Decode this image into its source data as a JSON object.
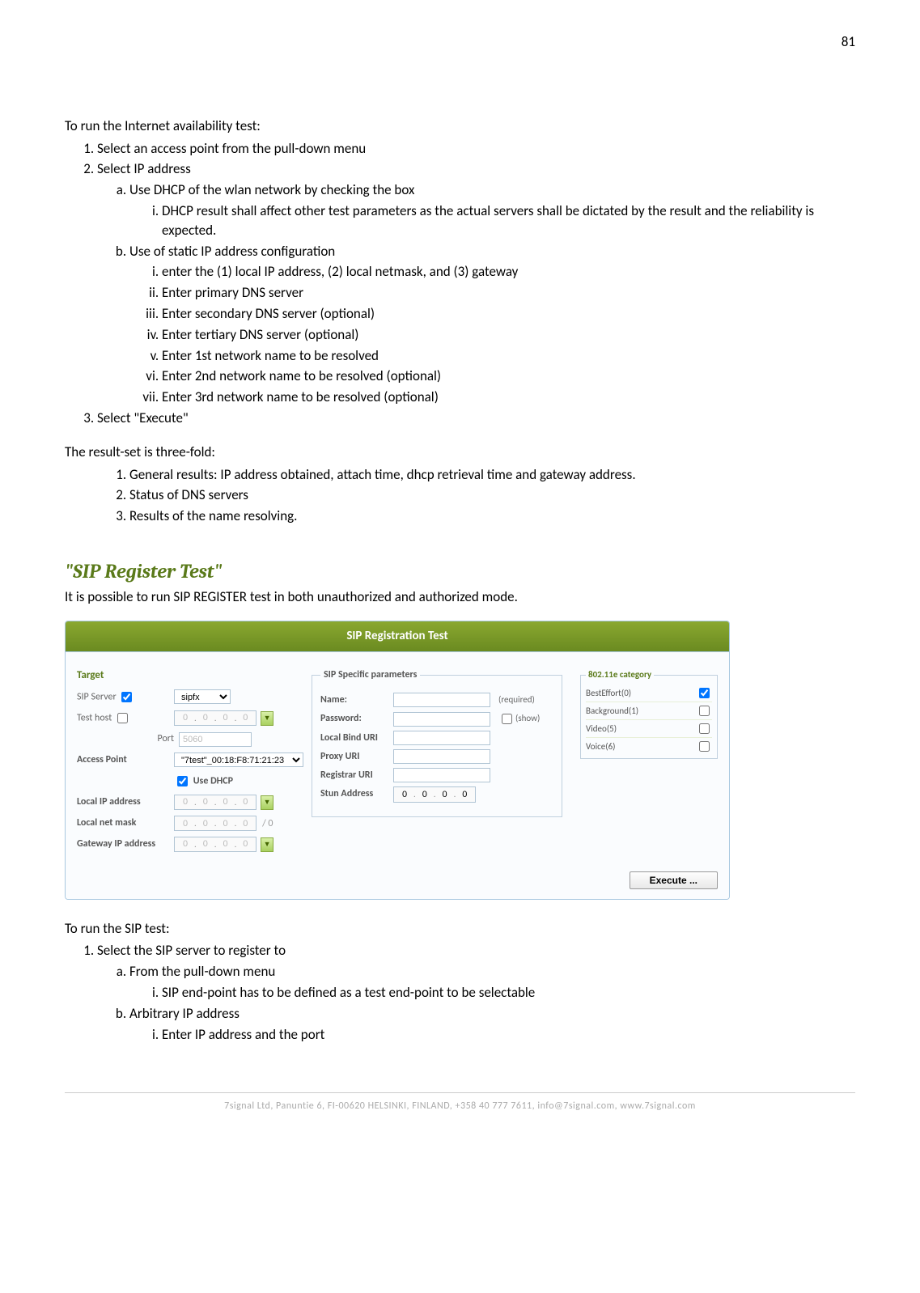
{
  "page_number": "81",
  "text": {
    "intro_internet": "To run the Internet availability test:",
    "step1": "Select an access point from the pull-down menu",
    "step2": "Select IP address",
    "step2a": "Use DHCP of the wlan network by checking the box",
    "step2a_i": "DHCP result shall affect other test parameters as the actual servers shall be dictated by the result and the reliability is expected.",
    "step2b": "Use of static IP address configuration",
    "step2b_i": "enter the (1) local IP address, (2) local netmask, and (3) gateway",
    "step2b_ii": "Enter primary DNS server",
    "step2b_iii": "Enter secondary DNS server (optional)",
    "step2b_iv": "Enter tertiary DNS server (optional)",
    "step2b_v": "Enter 1st network name to be resolved",
    "step2b_vi": "Enter 2nd network name to be resolved (optional)",
    "step2b_vii": "Enter 3rd network name to be resolved (optional)",
    "step3": "Select \"Execute\"",
    "result_intro": "The result-set is three-fold:",
    "result1": "General results: IP address obtained, attach time, dhcp retrieval time and gateway address.",
    "result2": "Status of DNS servers",
    "result3": "Results of the name resolving.",
    "sip_heading": "\"SIP Register Test\"",
    "sip_intro": "It is possible to run SIP REGISTER test in both unauthorized and authorized mode.",
    "sip_run_intro": "To run the SIP test:",
    "sip_step1": "Select the SIP server to register to",
    "sip_step1a": "From the pull-down menu",
    "sip_step1a_i": "SIP end-point has to be defined as a test end-point to be selectable",
    "sip_step1b": "Arbitrary IP address",
    "sip_step1b_i": "Enter IP address and the port"
  },
  "screenshot": {
    "header": "SIP Registration Test",
    "target": {
      "title": "Target",
      "sip_server_label": "SIP Server",
      "sip_server_value": "sipfx",
      "test_host_label": "Test host",
      "port_label": "Port",
      "port_value": "5060",
      "access_point_label": "Access Point",
      "access_point_value": "\"7test\"_00:18:F8:71:21:23",
      "use_dhcp_label": "Use DHCP",
      "local_ip_label": "Local IP address",
      "local_net_label": "Local net mask",
      "gateway_label": "Gateway IP address"
    },
    "sip_params": {
      "legend": "SIP Specific parameters",
      "name_label": "Name:",
      "name_hint": "(required)",
      "password_label": "Password:",
      "password_hint": "(show)",
      "local_bind_label": "Local Bind URI",
      "proxy_label": "Proxy URI",
      "registrar_label": "Registrar URI",
      "stun_label": "Stun Address",
      "stun_value": "0"
    },
    "categories": {
      "legend": "802.11e category",
      "items": [
        {
          "label": "BestEffort(0)",
          "checked": true
        },
        {
          "label": "Background(1)",
          "checked": false
        },
        {
          "label": "Video(5)",
          "checked": false
        },
        {
          "label": "Voice(6)",
          "checked": false
        }
      ]
    },
    "execute_label": "Execute ..."
  },
  "footer": "7signal Ltd, Panuntie 6, FI-00620 HELSINKI, FINLAND, +358 40 777 7611, info@7signal.com, www.7signal.com"
}
